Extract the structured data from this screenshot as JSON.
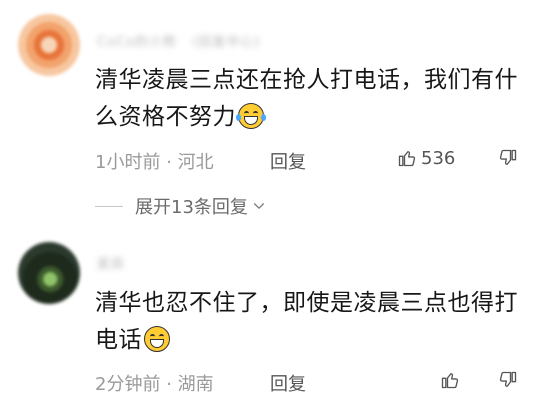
{
  "comments": [
    {
      "username": "CoCo的小熊",
      "badge": "(回复中心)",
      "text": "清华凌晨三点还在抢人打电话，我们有什么资格不努力",
      "emoji": "laughing-crying-emoji",
      "time": "1小时前",
      "separator": "·",
      "location": "河北",
      "reply_label": "回复",
      "likes": "536"
    },
    {
      "username": "星辰",
      "badge": "",
      "text": "清华也忍不住了，即使是凌晨三点也得打电话",
      "emoji": "grinning-emoji",
      "time": "2分钟前",
      "separator": "·",
      "location": "湖南",
      "reply_label": "回复",
      "likes": ""
    }
  ],
  "expand_replies": {
    "label": "展开13条回复"
  },
  "colors": {
    "text_primary": "#171717",
    "text_secondary": "#9a9a9a",
    "icon": "#555555"
  }
}
